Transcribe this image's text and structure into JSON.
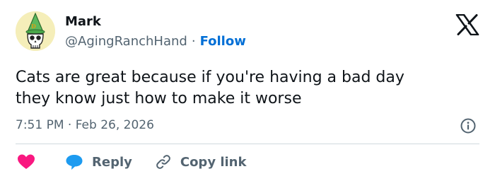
{
  "author": {
    "name": "Mark",
    "handle": "@AgingRanchHand",
    "separator": "·",
    "follow_label": "Follow",
    "avatar_icon": "skull-with-green-hat-icon"
  },
  "brand": {
    "logo_icon": "x-logo-icon"
  },
  "tweet": {
    "lines": [
      "Cats are great because if you're having a bad day",
      "they know just how to make it worse"
    ],
    "timestamp": "7:51 PM · Feb 26, 2026"
  },
  "actions": {
    "like_icon": "heart-icon",
    "reply_label": "Reply",
    "reply_icon": "speech-bubble-icon",
    "copy_label": "Copy link",
    "copy_icon": "link-icon",
    "info_icon": "info-icon"
  },
  "colors": {
    "accent": "#006fd6",
    "text": "#0f1419",
    "muted": "#536471",
    "heart": "#f91880",
    "reply_bubble": "#1d9bf0",
    "divider": "#cfd9de",
    "avatar_bg": "#f5eeb9",
    "hat": "#5cb85c"
  }
}
